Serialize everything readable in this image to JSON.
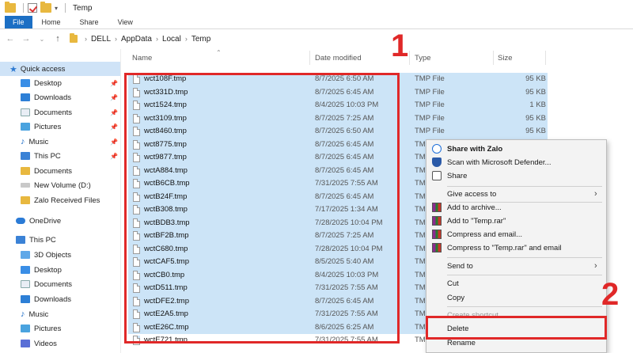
{
  "window": {
    "title": "Temp"
  },
  "ribbon": {
    "tabs": [
      "File",
      "Home",
      "Share",
      "View"
    ]
  },
  "address": {
    "breadcrumbs": [
      "DELL",
      "AppData",
      "Local",
      "Temp"
    ]
  },
  "navpane": {
    "quick_access": "Quick access",
    "items": [
      "Desktop",
      "Downloads",
      "Documents",
      "Pictures",
      "Music",
      "This PC",
      "Documents",
      "New Volume (D:)",
      "Zalo Received Files"
    ],
    "onedrive": "OneDrive",
    "this_pc": "This PC",
    "pc_items": [
      "3D Objects",
      "Desktop",
      "Documents",
      "Downloads",
      "Music",
      "Pictures",
      "Videos"
    ]
  },
  "columns": {
    "name": "Name",
    "date": "Date modified",
    "type": "Type",
    "size": "Size"
  },
  "files": [
    {
      "name": "wct108F.tmp",
      "date": "8/7/2025 6:50 AM",
      "type": "TMP File",
      "size": "95 KB"
    },
    {
      "name": "wct331D.tmp",
      "date": "8/7/2025 6:45 AM",
      "type": "TMP File",
      "size": "95 KB"
    },
    {
      "name": "wct1524.tmp",
      "date": "8/4/2025 10:03 PM",
      "type": "TMP File",
      "size": "1 KB"
    },
    {
      "name": "wct3109.tmp",
      "date": "8/7/2025 7:25 AM",
      "type": "TMP File",
      "size": "95 KB"
    },
    {
      "name": "wct8460.tmp",
      "date": "8/7/2025 6:50 AM",
      "type": "TMP File",
      "size": "95 KB"
    },
    {
      "name": "wct8775.tmp",
      "date": "8/7/2025 6:45 AM",
      "type": "TMP",
      "size": ""
    },
    {
      "name": "wct9877.tmp",
      "date": "8/7/2025 6:45 AM",
      "type": "TMP",
      "size": ""
    },
    {
      "name": "wctA884.tmp",
      "date": "8/7/2025 6:45 AM",
      "type": "TMP",
      "size": ""
    },
    {
      "name": "wctB6CB.tmp",
      "date": "7/31/2025 7:55 AM",
      "type": "TMP",
      "size": ""
    },
    {
      "name": "wctB24F.tmp",
      "date": "8/7/2025 6:45 AM",
      "type": "TMP",
      "size": ""
    },
    {
      "name": "wctB308.tmp",
      "date": "7/17/2025 1:34 AM",
      "type": "TMP",
      "size": ""
    },
    {
      "name": "wctBDB3.tmp",
      "date": "7/28/2025 10:04 PM",
      "type": "TMP",
      "size": ""
    },
    {
      "name": "wctBF2B.tmp",
      "date": "8/7/2025 7:25 AM",
      "type": "TMP",
      "size": ""
    },
    {
      "name": "wctC680.tmp",
      "date": "7/28/2025 10:04 PM",
      "type": "TMP",
      "size": ""
    },
    {
      "name": "wctCAF5.tmp",
      "date": "8/5/2025 5:40 AM",
      "type": "TMP",
      "size": ""
    },
    {
      "name": "wctCB0.tmp",
      "date": "8/4/2025 10:03 PM",
      "type": "TMP",
      "size": ""
    },
    {
      "name": "wctD511.tmp",
      "date": "7/31/2025 7:55 AM",
      "type": "TMP",
      "size": ""
    },
    {
      "name": "wctDFE2.tmp",
      "date": "8/7/2025 6:45 AM",
      "type": "TMP",
      "size": ""
    },
    {
      "name": "wctE2A5.tmp",
      "date": "7/31/2025 7:55 AM",
      "type": "TMP",
      "size": ""
    },
    {
      "name": "wctE26C.tmp",
      "date": "8/6/2025 6:25 AM",
      "type": "TMP",
      "size": ""
    },
    {
      "name": "wctE721.tmp",
      "date": "7/31/2025 7:55 AM",
      "type": "TMP",
      "size": ""
    }
  ],
  "context_menu": {
    "share_zalo": "Share with Zalo",
    "scan": "Scan with Microsoft Defender...",
    "share": "Share",
    "give_access": "Give access to",
    "add_archive": "Add to archive...",
    "add_rar": "Add to \"Temp.rar\"",
    "compress_email": "Compress and email...",
    "compress_rar_email": "Compress to \"Temp.rar\" and email",
    "send_to": "Send to",
    "cut": "Cut",
    "copy": "Copy",
    "create_shortcut": "Create shortcut",
    "delete": "Delete",
    "rename": "Rename"
  },
  "annotations": {
    "step1": "1",
    "step2": "2"
  }
}
